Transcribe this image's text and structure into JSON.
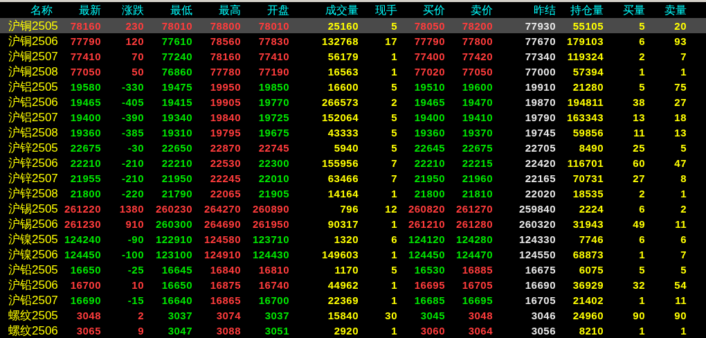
{
  "columns": [
    {
      "label": "名称",
      "kind": "name"
    },
    {
      "label": "最新",
      "kind": "price"
    },
    {
      "label": "涨跌",
      "kind": "price"
    },
    {
      "label": "最低",
      "kind": "price"
    },
    {
      "label": "最高",
      "kind": "price"
    },
    {
      "label": "开盘",
      "kind": "price"
    },
    {
      "label": "成交量",
      "kind": "volume"
    },
    {
      "label": "现手",
      "kind": "volume"
    },
    {
      "label": "买价",
      "kind": "price"
    },
    {
      "label": "卖价",
      "kind": "price"
    },
    {
      "label": "昨结",
      "kind": "ref"
    },
    {
      "label": "持仓量",
      "kind": "volume"
    },
    {
      "label": "买量",
      "kind": "volume"
    },
    {
      "label": "卖量",
      "kind": "volume"
    }
  ],
  "rows": [
    {
      "name": "沪铜2505",
      "selected": true,
      "cells": [
        {
          "text": "78160",
          "color": "#ff3c3c"
        },
        {
          "text": "230",
          "color": "#ff3c3c"
        },
        {
          "text": "78010",
          "color": "#ff3c3c"
        },
        {
          "text": "78800",
          "color": "#ff3c3c"
        },
        {
          "text": "78010",
          "color": "#ff3c3c"
        },
        {
          "text": "25160"
        },
        {
          "text": "5"
        },
        {
          "text": "78050",
          "color": "#ff3c3c"
        },
        {
          "text": "78200",
          "color": "#ff3c3c"
        },
        {
          "text": "77930"
        },
        {
          "text": "55105"
        },
        {
          "text": "5"
        },
        {
          "text": "20"
        }
      ]
    },
    {
      "name": "沪铜2506",
      "selected": false,
      "cells": [
        {
          "text": "77790",
          "color": "#ff3c3c"
        },
        {
          "text": "120",
          "color": "#ff3c3c"
        },
        {
          "text": "77610",
          "color": "#00e600"
        },
        {
          "text": "78560",
          "color": "#ff3c3c"
        },
        {
          "text": "77830",
          "color": "#ff3c3c"
        },
        {
          "text": "132768"
        },
        {
          "text": "17"
        },
        {
          "text": "77790",
          "color": "#ff3c3c"
        },
        {
          "text": "77800",
          "color": "#ff3c3c"
        },
        {
          "text": "77670"
        },
        {
          "text": "179103"
        },
        {
          "text": "6"
        },
        {
          "text": "93"
        }
      ]
    },
    {
      "name": "沪铜2507",
      "selected": false,
      "cells": [
        {
          "text": "77410",
          "color": "#ff3c3c"
        },
        {
          "text": "70",
          "color": "#ff3c3c"
        },
        {
          "text": "77240",
          "color": "#00e600"
        },
        {
          "text": "78160",
          "color": "#ff3c3c"
        },
        {
          "text": "77410",
          "color": "#ff3c3c"
        },
        {
          "text": "56179"
        },
        {
          "text": "1"
        },
        {
          "text": "77400",
          "color": "#ff3c3c"
        },
        {
          "text": "77420",
          "color": "#ff3c3c"
        },
        {
          "text": "77340"
        },
        {
          "text": "119324"
        },
        {
          "text": "2"
        },
        {
          "text": "7"
        }
      ]
    },
    {
      "name": "沪铜2508",
      "selected": false,
      "cells": [
        {
          "text": "77050",
          "color": "#ff3c3c"
        },
        {
          "text": "50",
          "color": "#ff3c3c"
        },
        {
          "text": "76860",
          "color": "#00e600"
        },
        {
          "text": "77780",
          "color": "#ff3c3c"
        },
        {
          "text": "77190",
          "color": "#ff3c3c"
        },
        {
          "text": "16563"
        },
        {
          "text": "1"
        },
        {
          "text": "77020",
          "color": "#ff3c3c"
        },
        {
          "text": "77050",
          "color": "#ff3c3c"
        },
        {
          "text": "77000"
        },
        {
          "text": "57394"
        },
        {
          "text": "1"
        },
        {
          "text": "1"
        }
      ]
    },
    {
      "name": "沪铝2505",
      "selected": false,
      "cells": [
        {
          "text": "19580",
          "color": "#00e600"
        },
        {
          "text": "-330",
          "color": "#00e600"
        },
        {
          "text": "19475",
          "color": "#00e600"
        },
        {
          "text": "19950",
          "color": "#ff3c3c"
        },
        {
          "text": "19850",
          "color": "#00e600"
        },
        {
          "text": "16600"
        },
        {
          "text": "5"
        },
        {
          "text": "19510",
          "color": "#00e600"
        },
        {
          "text": "19600",
          "color": "#00e600"
        },
        {
          "text": "19910"
        },
        {
          "text": "21280"
        },
        {
          "text": "5"
        },
        {
          "text": "75"
        }
      ]
    },
    {
      "name": "沪铝2506",
      "selected": false,
      "cells": [
        {
          "text": "19465",
          "color": "#00e600"
        },
        {
          "text": "-405",
          "color": "#00e600"
        },
        {
          "text": "19415",
          "color": "#00e600"
        },
        {
          "text": "19905",
          "color": "#ff3c3c"
        },
        {
          "text": "19770",
          "color": "#00e600"
        },
        {
          "text": "266573"
        },
        {
          "text": "2"
        },
        {
          "text": "19465",
          "color": "#00e600"
        },
        {
          "text": "19470",
          "color": "#00e600"
        },
        {
          "text": "19870"
        },
        {
          "text": "194811"
        },
        {
          "text": "38"
        },
        {
          "text": "27"
        }
      ]
    },
    {
      "name": "沪铝2507",
      "selected": false,
      "cells": [
        {
          "text": "19400",
          "color": "#00e600"
        },
        {
          "text": "-390",
          "color": "#00e600"
        },
        {
          "text": "19340",
          "color": "#00e600"
        },
        {
          "text": "19840",
          "color": "#ff3c3c"
        },
        {
          "text": "19725",
          "color": "#00e600"
        },
        {
          "text": "152064"
        },
        {
          "text": "5"
        },
        {
          "text": "19400",
          "color": "#00e600"
        },
        {
          "text": "19410",
          "color": "#00e600"
        },
        {
          "text": "19790"
        },
        {
          "text": "163343"
        },
        {
          "text": "13"
        },
        {
          "text": "18"
        }
      ]
    },
    {
      "name": "沪铝2508",
      "selected": false,
      "cells": [
        {
          "text": "19360",
          "color": "#00e600"
        },
        {
          "text": "-385",
          "color": "#00e600"
        },
        {
          "text": "19310",
          "color": "#00e600"
        },
        {
          "text": "19795",
          "color": "#ff3c3c"
        },
        {
          "text": "19675",
          "color": "#00e600"
        },
        {
          "text": "43333"
        },
        {
          "text": "5"
        },
        {
          "text": "19360",
          "color": "#00e600"
        },
        {
          "text": "19370",
          "color": "#00e600"
        },
        {
          "text": "19745"
        },
        {
          "text": "59856"
        },
        {
          "text": "11"
        },
        {
          "text": "13"
        }
      ]
    },
    {
      "name": "沪锌2505",
      "selected": false,
      "cells": [
        {
          "text": "22675",
          "color": "#00e600"
        },
        {
          "text": "-30",
          "color": "#00e600"
        },
        {
          "text": "22650",
          "color": "#00e600"
        },
        {
          "text": "22870",
          "color": "#ff3c3c"
        },
        {
          "text": "22745",
          "color": "#ff3c3c"
        },
        {
          "text": "5940"
        },
        {
          "text": "5"
        },
        {
          "text": "22645",
          "color": "#00e600"
        },
        {
          "text": "22675",
          "color": "#00e600"
        },
        {
          "text": "22705"
        },
        {
          "text": "8490"
        },
        {
          "text": "25"
        },
        {
          "text": "5"
        }
      ]
    },
    {
      "name": "沪锌2506",
      "selected": false,
      "cells": [
        {
          "text": "22210",
          "color": "#00e600"
        },
        {
          "text": "-210",
          "color": "#00e600"
        },
        {
          "text": "22210",
          "color": "#00e600"
        },
        {
          "text": "22530",
          "color": "#ff3c3c"
        },
        {
          "text": "22300",
          "color": "#00e600"
        },
        {
          "text": "155956"
        },
        {
          "text": "7"
        },
        {
          "text": "22210",
          "color": "#00e600"
        },
        {
          "text": "22215",
          "color": "#00e600"
        },
        {
          "text": "22420"
        },
        {
          "text": "116701"
        },
        {
          "text": "60"
        },
        {
          "text": "47"
        }
      ]
    },
    {
      "name": "沪锌2507",
      "selected": false,
      "cells": [
        {
          "text": "21955",
          "color": "#00e600"
        },
        {
          "text": "-210",
          "color": "#00e600"
        },
        {
          "text": "21950",
          "color": "#00e600"
        },
        {
          "text": "22245",
          "color": "#ff3c3c"
        },
        {
          "text": "22010",
          "color": "#00e600"
        },
        {
          "text": "63466"
        },
        {
          "text": "7"
        },
        {
          "text": "21950",
          "color": "#00e600"
        },
        {
          "text": "21960",
          "color": "#00e600"
        },
        {
          "text": "22165"
        },
        {
          "text": "70731"
        },
        {
          "text": "27"
        },
        {
          "text": "8"
        }
      ]
    },
    {
      "name": "沪锌2508",
      "selected": false,
      "cells": [
        {
          "text": "21800",
          "color": "#00e600"
        },
        {
          "text": "-220",
          "color": "#00e600"
        },
        {
          "text": "21790",
          "color": "#00e600"
        },
        {
          "text": "22065",
          "color": "#ff3c3c"
        },
        {
          "text": "21905",
          "color": "#00e600"
        },
        {
          "text": "14164"
        },
        {
          "text": "1"
        },
        {
          "text": "21800",
          "color": "#00e600"
        },
        {
          "text": "21810",
          "color": "#00e600"
        },
        {
          "text": "22020"
        },
        {
          "text": "18535"
        },
        {
          "text": "2"
        },
        {
          "text": "1"
        }
      ]
    },
    {
      "name": "沪锡2505",
      "selected": false,
      "cells": [
        {
          "text": "261220",
          "color": "#ff3c3c"
        },
        {
          "text": "1380",
          "color": "#ff3c3c"
        },
        {
          "text": "260230",
          "color": "#ff3c3c"
        },
        {
          "text": "264270",
          "color": "#ff3c3c"
        },
        {
          "text": "260890",
          "color": "#ff3c3c"
        },
        {
          "text": "796"
        },
        {
          "text": "12"
        },
        {
          "text": "260820",
          "color": "#ff3c3c"
        },
        {
          "text": "261270",
          "color": "#ff3c3c"
        },
        {
          "text": "259840"
        },
        {
          "text": "2224"
        },
        {
          "text": "6"
        },
        {
          "text": "2"
        }
      ]
    },
    {
      "name": "沪锡2506",
      "selected": false,
      "cells": [
        {
          "text": "261230",
          "color": "#ff3c3c"
        },
        {
          "text": "910",
          "color": "#ff3c3c"
        },
        {
          "text": "260300",
          "color": "#00e600"
        },
        {
          "text": "264690",
          "color": "#ff3c3c"
        },
        {
          "text": "261950",
          "color": "#ff3c3c"
        },
        {
          "text": "90317"
        },
        {
          "text": "1"
        },
        {
          "text": "261210",
          "color": "#ff3c3c"
        },
        {
          "text": "261280",
          "color": "#ff3c3c"
        },
        {
          "text": "260320"
        },
        {
          "text": "31943"
        },
        {
          "text": "49"
        },
        {
          "text": "11"
        }
      ]
    },
    {
      "name": "沪镍2505",
      "selected": false,
      "cells": [
        {
          "text": "124240",
          "color": "#00e600"
        },
        {
          "text": "-90",
          "color": "#00e600"
        },
        {
          "text": "122910",
          "color": "#00e600"
        },
        {
          "text": "124580",
          "color": "#ff3c3c"
        },
        {
          "text": "123710",
          "color": "#00e600"
        },
        {
          "text": "1320"
        },
        {
          "text": "6"
        },
        {
          "text": "124120",
          "color": "#00e600"
        },
        {
          "text": "124280",
          "color": "#00e600"
        },
        {
          "text": "124330"
        },
        {
          "text": "7746"
        },
        {
          "text": "6"
        },
        {
          "text": "6"
        }
      ]
    },
    {
      "name": "沪镍2506",
      "selected": false,
      "cells": [
        {
          "text": "124450",
          "color": "#00e600"
        },
        {
          "text": "-100",
          "color": "#00e600"
        },
        {
          "text": "123100",
          "color": "#00e600"
        },
        {
          "text": "124910",
          "color": "#ff3c3c"
        },
        {
          "text": "124430",
          "color": "#00e600"
        },
        {
          "text": "149603"
        },
        {
          "text": "1"
        },
        {
          "text": "124450",
          "color": "#00e600"
        },
        {
          "text": "124470",
          "color": "#00e600"
        },
        {
          "text": "124550"
        },
        {
          "text": "68873"
        },
        {
          "text": "1"
        },
        {
          "text": "7"
        }
      ]
    },
    {
      "name": "沪铅2505",
      "selected": false,
      "cells": [
        {
          "text": "16650",
          "color": "#00e600"
        },
        {
          "text": "-25",
          "color": "#00e600"
        },
        {
          "text": "16645",
          "color": "#00e600"
        },
        {
          "text": "16840",
          "color": "#ff3c3c"
        },
        {
          "text": "16810",
          "color": "#ff3c3c"
        },
        {
          "text": "1170"
        },
        {
          "text": "5"
        },
        {
          "text": "16530",
          "color": "#00e600"
        },
        {
          "text": "16885",
          "color": "#ff3c3c"
        },
        {
          "text": "16675"
        },
        {
          "text": "6075"
        },
        {
          "text": "5"
        },
        {
          "text": "5"
        }
      ]
    },
    {
      "name": "沪铅2506",
      "selected": false,
      "cells": [
        {
          "text": "16700",
          "color": "#ff3c3c"
        },
        {
          "text": "10",
          "color": "#ff3c3c"
        },
        {
          "text": "16650",
          "color": "#00e600"
        },
        {
          "text": "16875",
          "color": "#ff3c3c"
        },
        {
          "text": "16740",
          "color": "#ff3c3c"
        },
        {
          "text": "44962"
        },
        {
          "text": "1"
        },
        {
          "text": "16695",
          "color": "#ff3c3c"
        },
        {
          "text": "16705",
          "color": "#ff3c3c"
        },
        {
          "text": "16690"
        },
        {
          "text": "36929"
        },
        {
          "text": "32"
        },
        {
          "text": "54"
        }
      ]
    },
    {
      "name": "沪铅2507",
      "selected": false,
      "cells": [
        {
          "text": "16690",
          "color": "#00e600"
        },
        {
          "text": "-15",
          "color": "#00e600"
        },
        {
          "text": "16640",
          "color": "#00e600"
        },
        {
          "text": "16865",
          "color": "#ff3c3c"
        },
        {
          "text": "16700",
          "color": "#00e600"
        },
        {
          "text": "22369"
        },
        {
          "text": "1"
        },
        {
          "text": "16685",
          "color": "#00e600"
        },
        {
          "text": "16695",
          "color": "#00e600"
        },
        {
          "text": "16705"
        },
        {
          "text": "21402"
        },
        {
          "text": "1"
        },
        {
          "text": "11"
        }
      ]
    },
    {
      "name": "螺纹2505",
      "selected": false,
      "cells": [
        {
          "text": "3048",
          "color": "#ff3c3c"
        },
        {
          "text": "2",
          "color": "#ff3c3c"
        },
        {
          "text": "3037",
          "color": "#00e600"
        },
        {
          "text": "3074",
          "color": "#ff3c3c"
        },
        {
          "text": "3037",
          "color": "#00e600"
        },
        {
          "text": "15840"
        },
        {
          "text": "30"
        },
        {
          "text": "3045",
          "color": "#00e600"
        },
        {
          "text": "3048",
          "color": "#ff3c3c"
        },
        {
          "text": "3046"
        },
        {
          "text": "24960"
        },
        {
          "text": "90"
        },
        {
          "text": "90"
        }
      ]
    },
    {
      "name": "螺纹2506",
      "selected": false,
      "cells": [
        {
          "text": "3065",
          "color": "#ff3c3c"
        },
        {
          "text": "9",
          "color": "#ff3c3c"
        },
        {
          "text": "3047",
          "color": "#00e600"
        },
        {
          "text": "3088",
          "color": "#ff3c3c"
        },
        {
          "text": "3051",
          "color": "#00e600"
        },
        {
          "text": "2920"
        },
        {
          "text": "1"
        },
        {
          "text": "3060",
          "color": "#ff3c3c"
        },
        {
          "text": "3064",
          "color": "#ff3c3c"
        },
        {
          "text": "3056"
        },
        {
          "text": "8210"
        },
        {
          "text": "1"
        },
        {
          "text": "1"
        }
      ]
    }
  ]
}
